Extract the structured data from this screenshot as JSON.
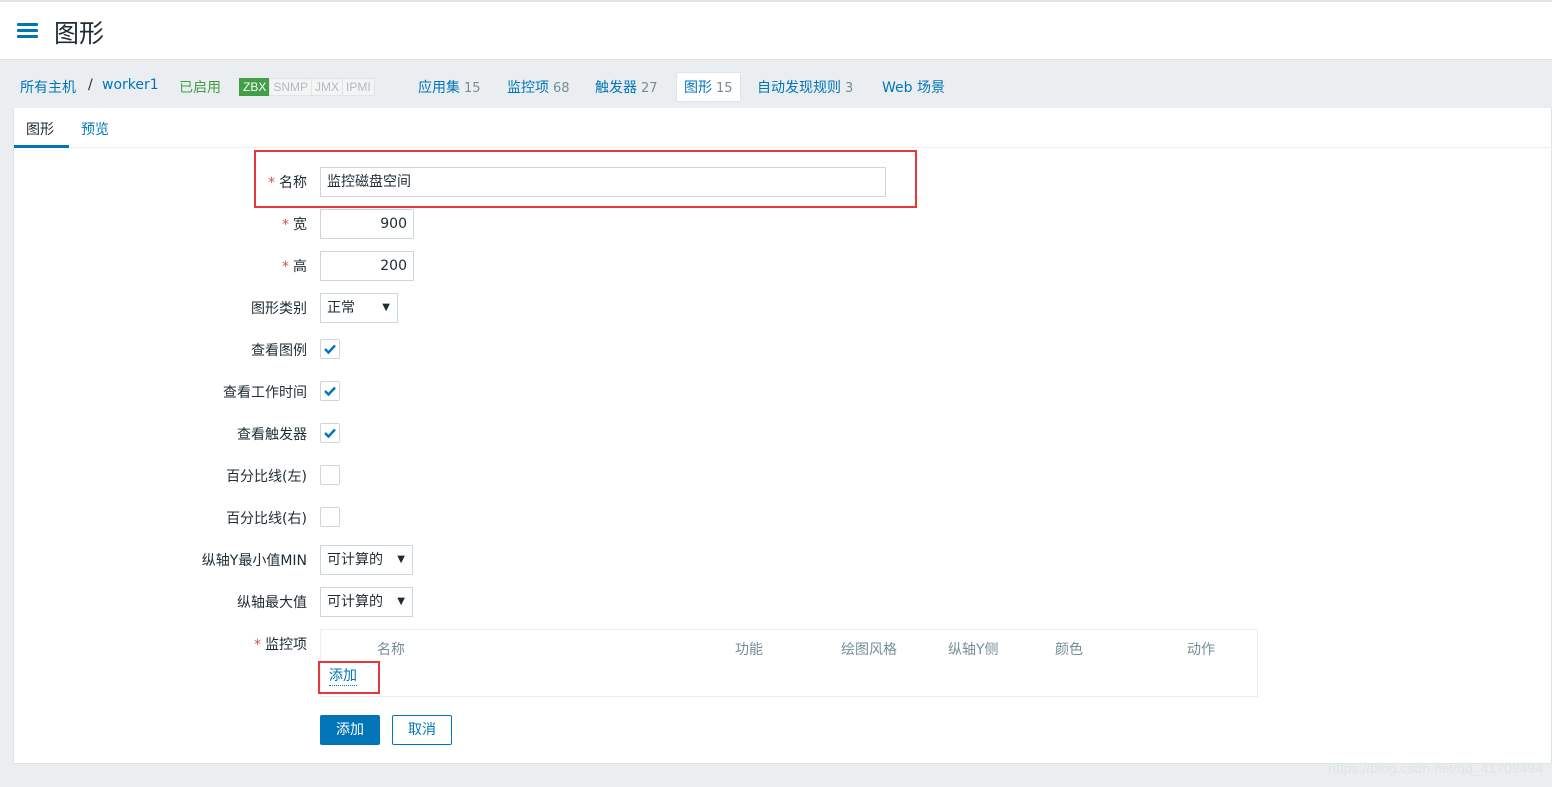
{
  "header": {
    "title": "图形"
  },
  "host_nav": {
    "all_hosts": "所有主机",
    "separator": "/",
    "host": "worker1",
    "status": "已启用",
    "badges": [
      "ZBX",
      "SNMP",
      "JMX",
      "IPMI"
    ],
    "applications": {
      "label": "应用集",
      "count": "15"
    },
    "items": {
      "label": "监控项",
      "count": "68"
    },
    "triggers": {
      "label": "触发器",
      "count": "27"
    },
    "graphs": {
      "label": "图形",
      "count": "15"
    },
    "discovery": {
      "label": "自动发现规则",
      "count": "3"
    },
    "web": "Web 场景"
  },
  "tabs": {
    "graph": "图形",
    "preview": "预览"
  },
  "form": {
    "required_mark": "*",
    "name": {
      "label": "名称",
      "value": "监控磁盘空间"
    },
    "width": {
      "label": "宽",
      "value": "900"
    },
    "height": {
      "label": "高",
      "value": "200"
    },
    "graph_type": {
      "label": "图形类别",
      "value": "正常"
    },
    "show_legend": {
      "label": "查看图例",
      "checked": true
    },
    "show_work_period": {
      "label": "查看工作时间",
      "checked": true
    },
    "show_triggers": {
      "label": "查看触发器",
      "checked": true
    },
    "percentile_left": {
      "label": "百分比线(左)",
      "checked": false
    },
    "percentile_right": {
      "label": "百分比线(右)",
      "checked": false
    },
    "y_min": {
      "label": "纵轴Y最小值MIN",
      "value": "可计算的"
    },
    "y_max": {
      "label": "纵轴最大值",
      "value": "可计算的"
    },
    "items": {
      "label": "监控项",
      "columns": [
        "名称",
        "功能",
        "绘图风格",
        "纵轴Y侧",
        "颜色",
        "动作"
      ],
      "add_link": "添加"
    }
  },
  "buttons": {
    "add": "添加",
    "cancel": "取消"
  },
  "watermark": "https://blog.csdn.net/qq_41709494",
  "colors": {
    "accent": "#0275b8",
    "enabled": "#429e47",
    "highlight": "#e5383b"
  }
}
